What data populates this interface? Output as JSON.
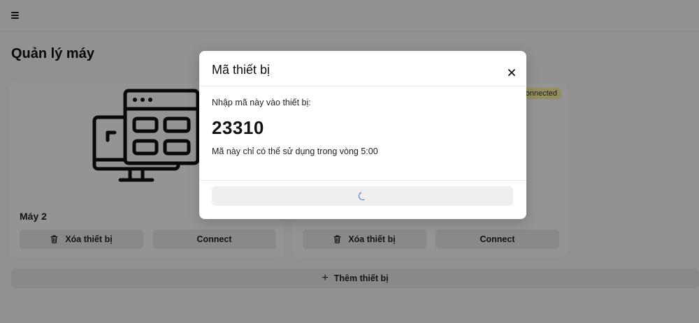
{
  "page": {
    "title": "Quản lý máy"
  },
  "devices": [
    {
      "name": "Máy 2",
      "delete_label": "Xóa thiết bị",
      "connect_label": "Connect"
    },
    {
      "name": "",
      "status": "Connected",
      "delete_label": "Xóa thiết bị",
      "connect_label": "Connect"
    }
  ],
  "add_device_label": "Thêm thiết bị",
  "modal": {
    "title": "Mã thiết bị",
    "prompt": "Nhập mã này vào thiết bị:",
    "code": "23310",
    "validity": "Mã này chỉ có thể sử dụng trong vòng 5:00"
  },
  "icons": {
    "menu": "menu-icon",
    "trash": "trash-icon",
    "plus": "plus-icon",
    "close": "close-icon",
    "device": "device-illustration-icon",
    "spinner": "loading-spinner-icon"
  },
  "colors": {
    "status_badge": "#fff4a3",
    "spinner": "#2f6fd6"
  }
}
